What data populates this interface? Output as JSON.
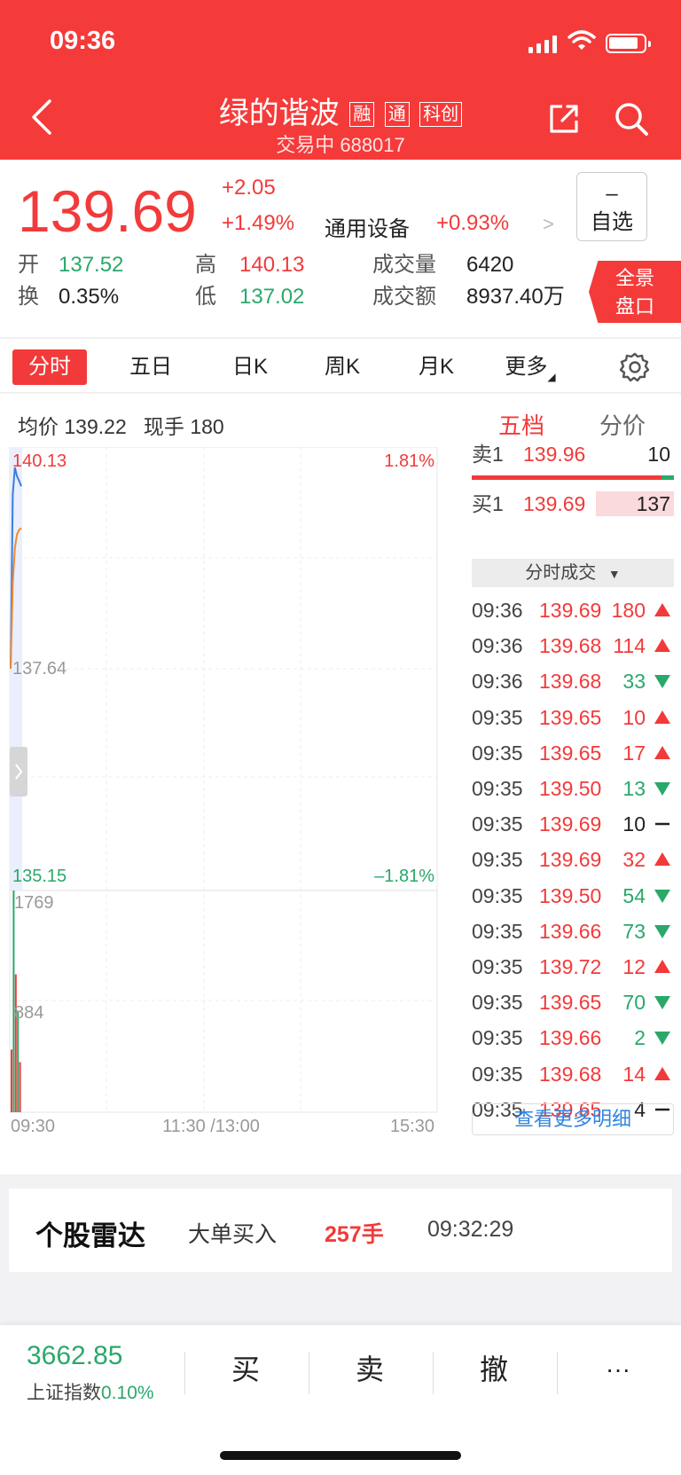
{
  "status": {
    "time": "09:36"
  },
  "header": {
    "title": "绿的谐波",
    "tags": [
      "融",
      "通",
      "科创"
    ],
    "subtitle": "交易中 688017"
  },
  "quote": {
    "price": "139.69",
    "change": "+2.05",
    "change_pct": "+1.49%",
    "sector": "通用设备",
    "sector_pct": "+0.93%",
    "favorite": {
      "sign": "–",
      "label": "自选"
    },
    "stats": [
      {
        "label": "开",
        "value": "137.52"
      },
      {
        "label": "换",
        "value": "0.35%"
      },
      {
        "label": "高",
        "value": "140.13"
      },
      {
        "label": "低",
        "value": "137.02"
      },
      {
        "label": "成交量",
        "value": "6420"
      },
      {
        "label": "成交额",
        "value": "8937.40万"
      }
    ],
    "panorama": [
      "全景",
      "盘口"
    ]
  },
  "tabs": [
    "分时",
    "五日",
    "日K",
    "周K",
    "月K",
    "更多"
  ],
  "info": {
    "avg_label": "均价",
    "avg_value": "139.22",
    "cur_label": "现手",
    "cur_value": "180",
    "right_tabs": [
      "五档",
      "分价"
    ]
  },
  "chart_data": {
    "type": "line",
    "price_axis": {
      "top": "140.13",
      "mid": "137.64",
      "bottom": "135.15",
      "top_pct": "1.81%",
      "bottom_pct": "–1.81%"
    },
    "volume_axis": {
      "max": "1769",
      "mid": "884"
    },
    "x_labels": [
      "09:30",
      "11:30 /13:00",
      "15:30"
    ],
    "price_series": [
      137.64,
      139.6,
      139.9,
      139.8,
      139.75,
      139.69
    ],
    "avg_series": [
      137.64,
      138.6,
      139.0,
      139.15,
      139.2,
      139.22
    ],
    "volume_bars": [
      {
        "v": 500,
        "c": "red"
      },
      {
        "v": 1769,
        "c": "green"
      },
      {
        "v": 1100,
        "c": "red"
      },
      {
        "v": 800,
        "c": "green"
      },
      {
        "v": 400,
        "c": "red"
      }
    ]
  },
  "order_book": {
    "sell": {
      "label": "卖1",
      "price": "139.96",
      "vol": "10"
    },
    "buy": {
      "label": "买1",
      "price": "139.69",
      "vol": "137"
    }
  },
  "trades_header": "分时成交",
  "trades": [
    {
      "t": "09:36",
      "p": "139.69",
      "v": "180",
      "d": "up"
    },
    {
      "t": "09:36",
      "p": "139.68",
      "v": "114",
      "d": "up"
    },
    {
      "t": "09:36",
      "p": "139.68",
      "v": "33",
      "d": "down"
    },
    {
      "t": "09:35",
      "p": "139.65",
      "v": "10",
      "d": "up"
    },
    {
      "t": "09:35",
      "p": "139.65",
      "v": "17",
      "d": "up"
    },
    {
      "t": "09:35",
      "p": "139.50",
      "v": "13",
      "d": "down"
    },
    {
      "t": "09:35",
      "p": "139.69",
      "v": "10",
      "d": "flat"
    },
    {
      "t": "09:35",
      "p": "139.69",
      "v": "32",
      "d": "up"
    },
    {
      "t": "09:35",
      "p": "139.50",
      "v": "54",
      "d": "down"
    },
    {
      "t": "09:35",
      "p": "139.66",
      "v": "73",
      "d": "down"
    },
    {
      "t": "09:35",
      "p": "139.72",
      "v": "12",
      "d": "up"
    },
    {
      "t": "09:35",
      "p": "139.65",
      "v": "70",
      "d": "down"
    },
    {
      "t": "09:35",
      "p": "139.66",
      "v": "2",
      "d": "down"
    },
    {
      "t": "09:35",
      "p": "139.68",
      "v": "14",
      "d": "up"
    },
    {
      "t": "09:35",
      "p": "139.65",
      "v": "4",
      "d": "flat"
    }
  ],
  "more_detail": "查看更多明细",
  "radar": {
    "title": "个股雷达",
    "type": "大单买入",
    "volume": "257手",
    "time": "09:32:29"
  },
  "bottom": {
    "index_value": "3662.85",
    "index_name": "上证指数",
    "index_pct": "0.10%",
    "actions": [
      "买",
      "卖",
      "撤",
      "···"
    ]
  },
  "colors": {
    "brand": "#f53a3a",
    "up": "#f23a3a",
    "down": "#2aa86a",
    "price_line": "#3b7de0",
    "avg_line": "#f08a30"
  }
}
